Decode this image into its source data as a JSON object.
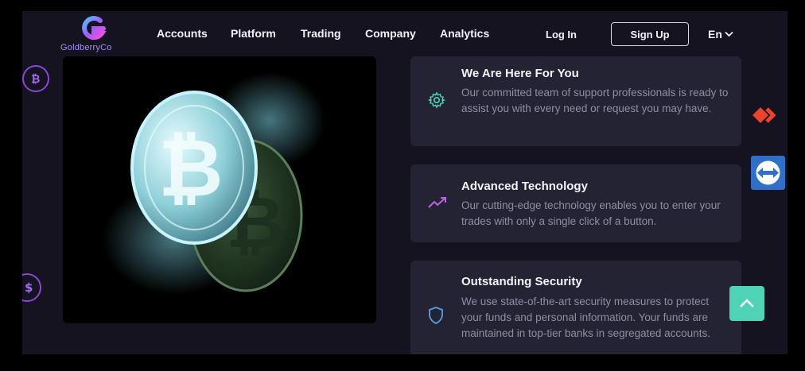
{
  "brand": {
    "name": "GoldberryCo"
  },
  "nav": {
    "items": [
      {
        "label": "Accounts"
      },
      {
        "label": "Platform"
      },
      {
        "label": "Trading"
      },
      {
        "label": "Company"
      },
      {
        "label": "Analytics"
      }
    ],
    "login": "Log In",
    "signup": "Sign Up",
    "language": "En"
  },
  "side_icons": [
    "bitcoin-icon",
    "dollar-icon"
  ],
  "features": [
    {
      "title": "We Are Here For You",
      "description": "Our committed team of support professionals is ready to assist you with every need or request you may have.",
      "icon": "gear-icon"
    },
    {
      "title": "Advanced Technology",
      "description": "Our cutting-edge technology enables you to enter your trades with only a single click of a button.",
      "icon": "trend-up-icon"
    },
    {
      "title": "Outstanding Security",
      "description": "We use state-of-the-art security measures to protect your funds and personal information. Your funds are maintained in top-tier banks in segregated accounts.",
      "icon": "shield-icon"
    }
  ],
  "colors": {
    "background": "#14131f",
    "card": "#232333",
    "accent_purple": "#a66bf0",
    "accent_teal": "#4fd3b6",
    "text": "#f4f4f8",
    "muted": "#8e8ea3"
  }
}
